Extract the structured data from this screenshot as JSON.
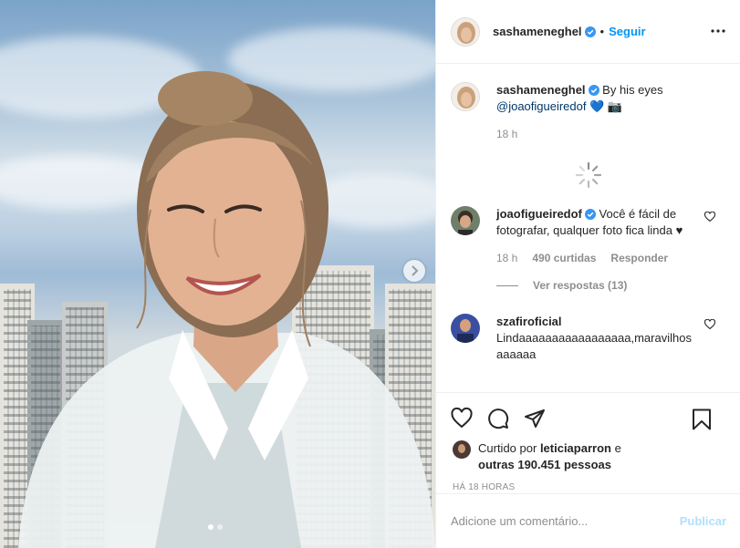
{
  "post": {
    "image_alt": "Woman smiling with city skyline behind",
    "carousel_dot_count": 2,
    "carousel_active_index": 0
  },
  "header": {
    "username": "sashameneghel",
    "separator": "•",
    "follow_label": "Seguir"
  },
  "caption": {
    "username": "sashameneghel",
    "text": "By his eyes",
    "mention": "@joaofigueiredof",
    "emoji": "💙 📷",
    "time": "18 h"
  },
  "comments": [
    {
      "username": "joaofigueiredof",
      "text": "Você é fácil de fotografar, qualquer foto fica linda ♥",
      "time": "18 h",
      "likes": "490 curtidas",
      "reply_label": "Responder",
      "view_replies": "Ver respostas (13)"
    },
    {
      "username": "szafiroficial",
      "text": "Lindaaaaaaaaaaaaaaaaa,maravilhosaaaaaa"
    }
  ],
  "likes": {
    "prefix": "Curtido por",
    "user": "leticiaparron",
    "middle": "e",
    "others": "outras 190.451 pessoas"
  },
  "posted_time": "HÁ 18 HORAS",
  "add_comment": {
    "placeholder": "Adicione um comentário...",
    "publish_label": "Publicar"
  },
  "colors": {
    "accent": "#0095f6",
    "verified": "#3897f0",
    "publish_disabled": "#b2dffc",
    "secondary_text": "#8e8e8e"
  }
}
